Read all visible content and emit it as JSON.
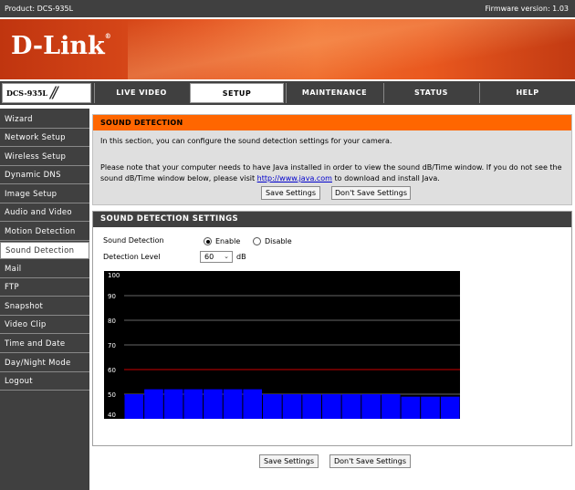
{
  "topbar": {
    "product": "Product: DCS-935L",
    "firmware": "Firmware version: 1.03"
  },
  "brand": {
    "logo": "D-Link",
    "registered": "®"
  },
  "nav": {
    "model": "DCS-935L",
    "tabs": [
      {
        "label": "LIVE VIDEO",
        "active": false
      },
      {
        "label": "SETUP",
        "active": true
      },
      {
        "label": "MAINTENANCE",
        "active": false
      },
      {
        "label": "STATUS",
        "active": false
      },
      {
        "label": "HELP",
        "active": false
      }
    ]
  },
  "sidebar": {
    "items": [
      {
        "label": "Wizard"
      },
      {
        "label": "Network Setup"
      },
      {
        "label": "Wireless Setup"
      },
      {
        "label": "Dynamic DNS"
      },
      {
        "label": "Image Setup"
      },
      {
        "label": "Audio and Video"
      },
      {
        "label": "Motion Detection"
      },
      {
        "label": "Sound Detection",
        "active": true
      },
      {
        "label": "Mail"
      },
      {
        "label": "FTP"
      },
      {
        "label": "Snapshot"
      },
      {
        "label": "Video Clip"
      },
      {
        "label": "Time and Date"
      },
      {
        "label": "Day/Night Mode"
      },
      {
        "label": "Logout"
      }
    ]
  },
  "intro": {
    "title": "SOUND DETECTION",
    "text1": "In this section, you can configure the sound detection settings for your camera.",
    "text2_before": "Please note that your computer needs to have Java installed in order to view the sound dB/Time window. If you do not see the sound dB/Time window below, please visit ",
    "link": "http://www.java.com",
    "text2_after": " to download and install Java.",
    "save_label": "Save Settings",
    "dont_save_label": "Don't Save Settings"
  },
  "settings": {
    "title": "SOUND DETECTION SETTINGS",
    "detection_label": "Sound Detection",
    "enable_label": "Enable",
    "disable_label": "Disable",
    "enabled": true,
    "level_label": "Detection Level",
    "level_value": "60",
    "level_unit": "dB"
  },
  "bottom": {
    "save_label": "Save Settings",
    "dont_save_label": "Don't Save Settings"
  },
  "colors": {
    "orange": "#ff6600",
    "dark": "#404040",
    "bar": "#0000ff",
    "threshold": "#cc0000"
  },
  "chart_data": {
    "type": "bar",
    "ylim": [
      40,
      100
    ],
    "yticks": [
      "100",
      "90",
      "80",
      "70",
      "60",
      "50",
      "40"
    ],
    "threshold": 60,
    "values": [
      50,
      52,
      52,
      52,
      52,
      52,
      52,
      50,
      50,
      50,
      50,
      50,
      50,
      50,
      49,
      49,
      49
    ]
  }
}
